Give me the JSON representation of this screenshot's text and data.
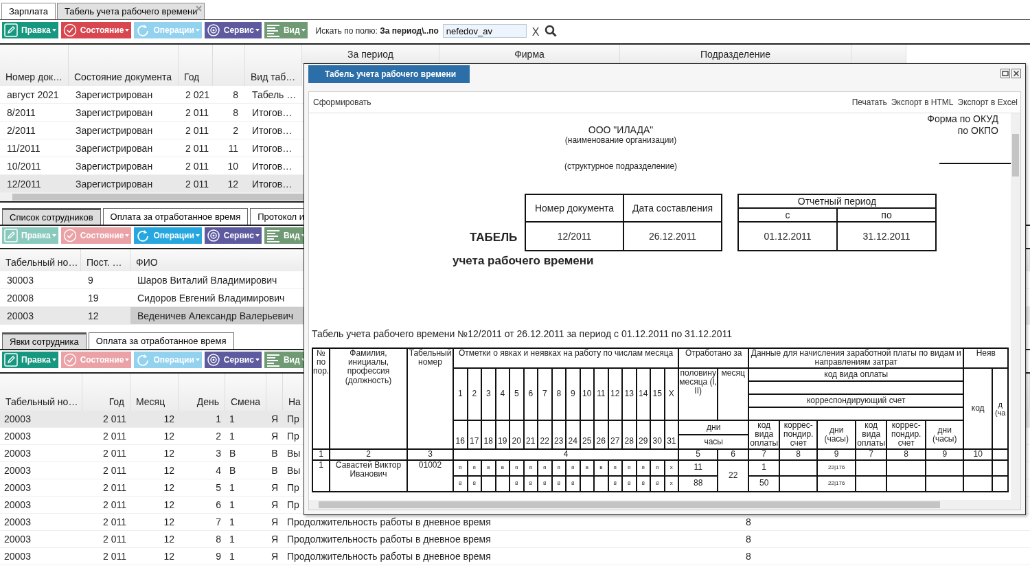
{
  "app_tabs": [
    {
      "label": "Зарплата",
      "selected": false,
      "closable": false
    },
    {
      "label": "Табель учета рабочего времени",
      "selected": true,
      "closable": true
    }
  ],
  "toolbar": {
    "buttons": [
      {
        "label": "Правка",
        "kind": "edit",
        "disabled": false
      },
      {
        "label": "Состояние",
        "kind": "state",
        "disabled": false
      },
      {
        "label": "Операции",
        "kind": "operations",
        "disabled": true
      },
      {
        "label": "Сервис",
        "kind": "service",
        "disabled": false
      },
      {
        "label": "Вид",
        "kind": "view",
        "disabled": false
      }
    ],
    "search_label": "Искать по полю: **За период\\..по**",
    "search_value": "nefedov_av",
    "clear": "X"
  },
  "documents_grid": {
    "columns": [
      {
        "label": "Номер док…"
      },
      {
        "label": "Состояние документа"
      },
      {
        "label": "Год"
      },
      {},
      {
        "label": "Вид таб…"
      }
    ],
    "group_headers": [
      "За период",
      "Фирма",
      "Подразделение"
    ],
    "rows": [
      {
        "cells": [
          "август 2021",
          "Зарегистрирован",
          "2 021",
          "8",
          "Табель …"
        ],
        "selected": false
      },
      {
        "cells": [
          "8/2011",
          "Зарегистрирован",
          "2 011",
          "8",
          "Итогов…"
        ],
        "selected": false
      },
      {
        "cells": [
          "2/2011",
          "Зарегистрирован",
          "2 011",
          "2",
          "Итогов…"
        ],
        "selected": false
      },
      {
        "cells": [
          "11/2011",
          "Зарегистрирован",
          "2 011",
          "11",
          "Итогов…"
        ],
        "selected": false
      },
      {
        "cells": [
          "10/2011",
          "Зарегистрирован",
          "2 011",
          "10",
          "Итогов…"
        ],
        "selected": false
      },
      {
        "cells": [
          "12/2011",
          "Зарегистрирован",
          "2 011",
          "12",
          "Итогов…"
        ],
        "selected": true
      }
    ]
  },
  "employee_tabs": [
    {
      "label": "Список сотрудников",
      "selected": true
    },
    {
      "label": "Оплата за отработанное время",
      "selected": false
    },
    {
      "label": "Протокол и",
      "selected": false
    }
  ],
  "employee_toolbar": {
    "buttons": [
      {
        "label": "Правка",
        "kind": "edit",
        "disabled": true
      },
      {
        "label": "Состояние",
        "kind": "state",
        "disabled": true
      },
      {
        "label": "Операции",
        "kind": "operations",
        "disabled": false
      },
      {
        "label": "Сервис",
        "kind": "service",
        "disabled": false
      },
      {
        "label": "Вид",
        "kind": "view",
        "disabled": false
      }
    ]
  },
  "employees_grid": {
    "columns": [
      "Табельный но…",
      "Пост. …",
      "ФИО"
    ],
    "rows": [
      {
        "cells": [
          "30003",
          "9",
          "Шаров Виталий Владимирович"
        ],
        "selected": false
      },
      {
        "cells": [
          "20008",
          "19",
          "Сидоров Евгений Владимирович"
        ],
        "selected": false
      },
      {
        "cells": [
          "20003",
          "12",
          "Веденичев Александр Валерьевич"
        ],
        "selected": true
      }
    ]
  },
  "attendance_tabs": [
    {
      "label": "Явки сотрудника",
      "selected": true
    },
    {
      "label": "Оплата за отработанное время",
      "selected": false
    }
  ],
  "attendance_toolbar": {
    "buttons": [
      {
        "label": "Правка",
        "kind": "edit",
        "disabled": false
      },
      {
        "label": "Состояние",
        "kind": "state",
        "disabled": true
      },
      {
        "label": "Операции",
        "kind": "operations",
        "disabled": true
      },
      {
        "label": "Сервис",
        "kind": "service",
        "disabled": false
      },
      {
        "label": "Вид",
        "kind": "view",
        "disabled": false
      }
    ]
  },
  "attendance_grid": {
    "columns": [
      {
        "label": "Табельный но…"
      },
      {
        "label": "Год"
      },
      {
        "label": "Месяц"
      },
      {
        "label": "День"
      },
      {
        "label": "Смена"
      },
      {},
      {
        "label": "На"
      },
      {}
    ],
    "rows": [
      {
        "cells": [
          "20003",
          "2 011",
          "12",
          "1",
          "1",
          "Я",
          "Пр"
        ],
        "selected": true
      },
      {
        "cells": [
          "20003",
          "2 011",
          "12",
          "2",
          "1",
          "Я",
          "Пр"
        ],
        "selected": false
      },
      {
        "cells": [
          "20003",
          "2 011",
          "12",
          "3",
          "В",
          "В",
          "Вы"
        ],
        "selected": false
      },
      {
        "cells": [
          "20003",
          "2 011",
          "12",
          "4",
          "В",
          "В",
          "Вы"
        ],
        "selected": false
      },
      {
        "cells": [
          "20003",
          "2 011",
          "12",
          "5",
          "1",
          "Я",
          "Пр"
        ],
        "selected": false
      },
      {
        "cells": [
          "20003",
          "2 011",
          "12",
          "6",
          "1",
          "Я",
          "Пр"
        ],
        "selected": false
      },
      {
        "cells": [
          "20003",
          "2 011",
          "12",
          "7",
          "1",
          "Я",
          "Продолжительность работы в дневное время",
          "8"
        ],
        "selected": false
      },
      {
        "cells": [
          "20003",
          "2 011",
          "12",
          "8",
          "1",
          "Я",
          "Продолжительность работы в дневное время",
          "8"
        ],
        "selected": false
      },
      {
        "cells": [
          "20003",
          "2 011",
          "12",
          "9",
          "1",
          "Я",
          "Продолжительность работы в дневное время",
          "8"
        ],
        "selected": false
      }
    ]
  },
  "dialog": {
    "title": "Табель учета рабочего времени",
    "toolbar": {
      "left": [
        "Сформировать"
      ],
      "right": [
        "Печатать",
        "Экспорт в HTML",
        "Экспорт в Excel"
      ]
    },
    "report": {
      "form_labels": [
        "Форма по ОКУД",
        "по ОКПО"
      ],
      "organization": "ООО \"ИЛАДА\"",
      "organization_caption": "(наименование организации)",
      "department_caption": "(структурное подразделение)",
      "title": "ТАБЕЛЬ",
      "subtitle": "учета рабочего времени",
      "doc_box": {
        "headers": [
          "Номер документа",
          "Дата составления"
        ],
        "values": [
          "12/2011",
          "26.12.2011"
        ]
      },
      "period_box": {
        "title": "Отчетный период",
        "headers": [
          "с",
          "по"
        ],
        "values": [
          "01.12.2011",
          "31.12.2011"
        ]
      },
      "summary": "Табель учета рабочего времени №12/2011 от 26.12.2011 за период с 01.12.2011 по 31.12.2011",
      "timesheet": {
        "headers": {
          "number": "№ по пор.",
          "name": "Фамилия, инициалы, профессия (должность)",
          "tab_number": "Табельный номер",
          "marks": "Отметки о явках и неявках на работу по числам месяца",
          "worked": "Отработано за",
          "pay_data": "Данные для начисления заработной платы по видам и направлениям затрат",
          "absence": "Неяв",
          "half_month": "половину месяца (I, II)",
          "month": "месяц",
          "pay_code": "код вида оплаты",
          "account": "корреспондирующий счет",
          "days": "дни",
          "hours": "часы",
          "absence_code": "код",
          "absence_days": "д (ча"
        },
        "sub_headers": [
          "код вида оплаты",
          "коррес-пондир. счет",
          "дни (часы)",
          "код вида оплаты",
          "коррес-пондир. счет",
          "дни (часы)"
        ],
        "days_first": [
          "1",
          "2",
          "3",
          "4",
          "5",
          "6",
          "7",
          "8",
          "9",
          "10",
          "11",
          "12",
          "13",
          "14",
          "15",
          "X"
        ],
        "days_second": [
          "16",
          "17",
          "18",
          "19",
          "20",
          "21",
          "22",
          "23",
          "24",
          "25",
          "26",
          "27",
          "28",
          "29",
          "30",
          "31"
        ],
        "column_numbers": [
          "1",
          "2",
          "3",
          "4",
          "5",
          "6",
          "7",
          "8",
          "9",
          "7",
          "8",
          "9",
          "10"
        ],
        "rows": [
          {
            "number": "1",
            "name": "Савастей Виктор Иванович",
            "tab_number": "01002",
            "marks": [
              "я",
              "я",
              "в",
              "в",
              "я",
              "я",
              "я",
              "я",
              "я",
              "в",
              "в",
              "я",
              "я",
              "я",
              "я",
              "х"
            ],
            "hours": [
              {
                "kind": "value",
                "value": "8"
              },
              {
                "kind": "value",
                "value": "8"
              },
              {
                "kind": "blank"
              },
              {
                "kind": "blank"
              },
              {
                "kind": "value",
                "value": "8"
              },
              {
                "kind": "value",
                "value": "8"
              },
              {
                "kind": "value",
                "value": "8"
              },
              {
                "kind": "value",
                "value": "8"
              },
              {
                "kind": "value",
                "value": "8"
              },
              {
                "kind": "blank"
              },
              {
                "kind": "blank"
              },
              {
                "kind": "value",
                "value": "8"
              },
              {
                "kind": "value",
                "value": "8"
              },
              {
                "kind": "value",
                "value": "8"
              },
              {
                "kind": "value",
                "value": "8"
              },
              {
                "kind": "value",
                "value": "х"
              }
            ],
            "half_days": "11",
            "half_hours": "88",
            "month": "22",
            "pay_first": [
              {
                "kind": "value",
                "value": "1"
              },
              {
                "kind": "blank"
              },
              {
                "kind": "value",
                "value": "22|176"
              },
              {
                "kind": "blank"
              },
              {
                "kind": "blank"
              },
              {
                "kind": "blank"
              }
            ],
            "pay_second": [
              {
                "kind": "value",
                "value": "50"
              },
              {
                "kind": "blank"
              },
              {
                "kind": "value",
                "value": "22|176"
              },
              {
                "kind": "blank"
              },
              {
                "kind": "blank"
              },
              {
                "kind": "blank"
              }
            ]
          }
        ]
      }
    }
  }
}
